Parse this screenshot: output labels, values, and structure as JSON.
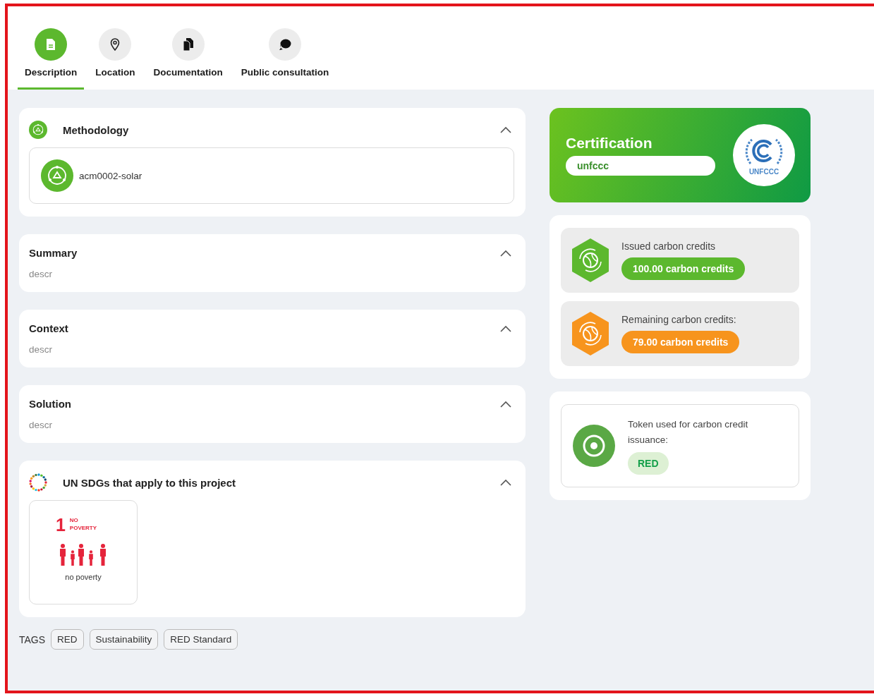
{
  "tabs": [
    {
      "label": "Description",
      "kind": "document",
      "selected": true
    },
    {
      "label": "Location",
      "kind": "location",
      "selected": false
    },
    {
      "label": "Documentation",
      "kind": "documents",
      "selected": false
    },
    {
      "label": "Public consultation",
      "kind": "consultation",
      "selected": false
    }
  ],
  "sections": [
    {
      "kind": "methodology",
      "title": "Methodology",
      "expanded": true,
      "item": "acm0002-solar"
    },
    {
      "kind": "text",
      "title": "Summary",
      "expanded": true,
      "body": "descr"
    },
    {
      "kind": "text",
      "title": "Context",
      "expanded": true,
      "body": "descr"
    },
    {
      "kind": "text",
      "title": "Solution",
      "expanded": true,
      "body": "descr"
    },
    {
      "kind": "sdgs",
      "title": "UN SDGs that apply to this project",
      "expanded": true,
      "goals": [
        {
          "number": "1",
          "name_lines": [
            "NO",
            "POVERTY"
          ],
          "caption": "no poverty",
          "color": "#e5243b"
        }
      ]
    }
  ],
  "tags": {
    "label": "TAGS",
    "items": [
      "RED",
      "Sustainability",
      "RED Standard"
    ]
  },
  "certification": {
    "title": "Certification",
    "value": "unfccc",
    "logo_text": "UNFCCC"
  },
  "credits": [
    {
      "label": "Issued carbon credits",
      "amount": "100.00 carbon credits",
      "color": "#5cb82e"
    },
    {
      "label": "Remaining carbon credits:",
      "amount": "79.00 carbon credits",
      "color": "#f7941d"
    }
  ],
  "token": {
    "label": "Token used for carbon credit issuance:",
    "value": "RED"
  }
}
